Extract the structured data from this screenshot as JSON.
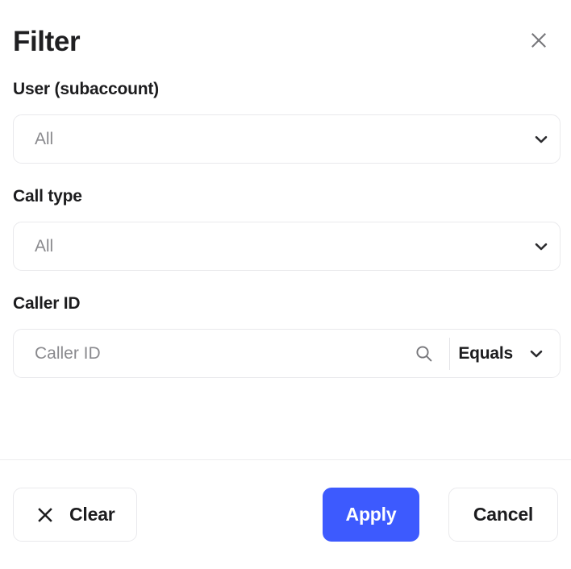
{
  "header": {
    "title": "Filter",
    "close_icon": "close-icon"
  },
  "fields": [
    {
      "label": "User (subaccount)",
      "value": "All",
      "chevron_icon": "chevron-down-icon"
    },
    {
      "label": "Call type",
      "value": "All",
      "chevron_icon": "chevron-down-icon"
    }
  ],
  "caller_id": {
    "label": "Caller ID",
    "placeholder": "Caller ID",
    "value": "",
    "search_icon": "search-icon",
    "operator": "Equals",
    "operator_chevron_icon": "chevron-down-icon"
  },
  "footer": {
    "clear_label": "Clear",
    "clear_icon": "close-icon",
    "apply_label": "Apply",
    "cancel_label": "Cancel"
  },
  "colors": {
    "accent": "#3d5afe",
    "text": "#1c1c1e",
    "muted_text": "#8a8a8e",
    "border": "#e9e9ec",
    "divider": "#ececee",
    "background": "#ffffff"
  }
}
